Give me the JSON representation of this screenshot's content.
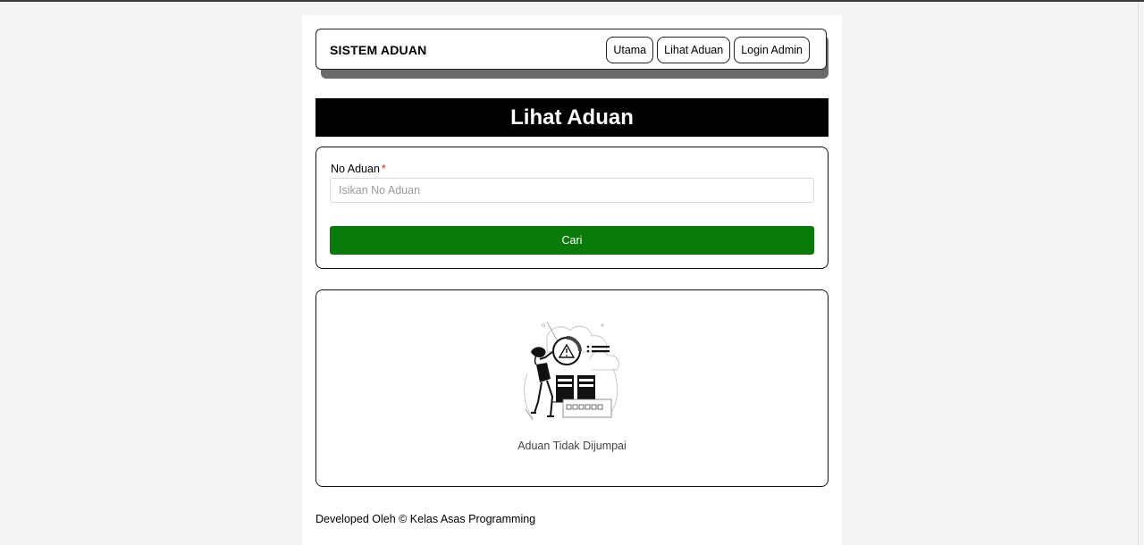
{
  "navbar": {
    "brand": "SISTEM ADUAN",
    "links": [
      "Utama",
      "Lihat Aduan",
      "Login Admin"
    ]
  },
  "page_title": "Lihat Aduan",
  "form": {
    "label": "No Aduan",
    "required_mark": "*",
    "placeholder": "Isikan No Aduan",
    "value": "",
    "button_label": "Cari"
  },
  "result": {
    "illustration": "not-found-illustration",
    "message": "Aduan Tidak Dijumpai"
  },
  "footer": "Developed Oleh © Kelas Asas Programming",
  "colors": {
    "button_green": "#0a7a0a",
    "title_bar": "#000000",
    "required": "#e02020"
  }
}
